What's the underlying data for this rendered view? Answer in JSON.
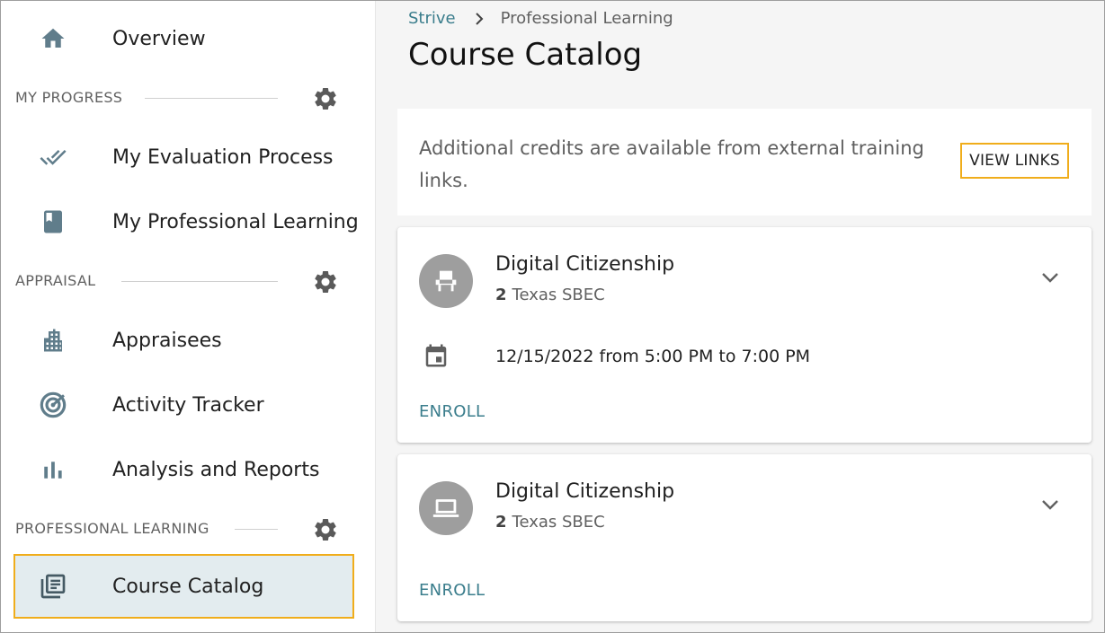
{
  "sidebar": {
    "overview": {
      "label": "Overview",
      "icon": "home-icon"
    },
    "sections": [
      {
        "label": "MY PROGRESS",
        "items": [
          {
            "label": "My Evaluation Process",
            "icon": "double-check-icon"
          },
          {
            "label": "My Professional Learning",
            "icon": "book-icon"
          }
        ]
      },
      {
        "label": "APPRAISAL",
        "items": [
          {
            "label": "Appraisees",
            "icon": "building-icon"
          },
          {
            "label": "Activity Tracker",
            "icon": "target-icon"
          },
          {
            "label": "Analysis and Reports",
            "icon": "bar-chart-icon"
          }
        ]
      },
      {
        "label": "PROFESSIONAL LEARNING",
        "items": [
          {
            "label": "Course Catalog",
            "icon": "catalog-icon",
            "active": true
          }
        ]
      }
    ]
  },
  "breadcrumb": {
    "root": "Strive",
    "current": "Professional Learning"
  },
  "page_title": "Course Catalog",
  "info": {
    "text": "Additional credits are available from external training links.",
    "button": "VIEW LINKS"
  },
  "courses": [
    {
      "title": "Digital Citizenship",
      "credits": "2",
      "credit_type": "Texas SBEC",
      "icon": "chair-icon",
      "session": "12/15/2022 from 5:00 PM to 7:00 PM",
      "action": "ENROLL"
    },
    {
      "title": "Digital Citizenship",
      "credits": "2",
      "credit_type": "Texas SBEC",
      "icon": "laptop-icon",
      "action": "ENROLL"
    }
  ],
  "colors": {
    "accent": "#3a7d8c",
    "highlight": "#f0ad1b",
    "icon_gray": "#607d8b",
    "active_bg": "#e3ecef"
  }
}
